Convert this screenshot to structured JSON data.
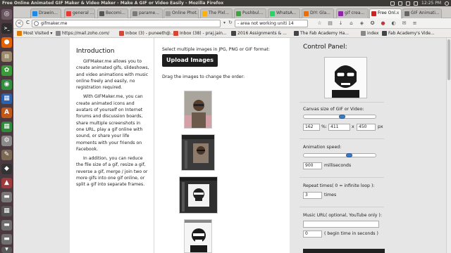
{
  "topbar": {
    "title": "Free Online Animated GIF Maker & Video Maker - Make A GIF or Video Easily - Mozilla Firefox",
    "time": "12:25 PM"
  },
  "tabs": [
    {
      "label": "Drawin...",
      "color": "#1e88e5"
    },
    {
      "label": "general ...",
      "color": "#e53935"
    },
    {
      "label": "Becomi...",
      "color": "#555555"
    },
    {
      "label": "parame...",
      "color": "#7a7a7a"
    },
    {
      "label": "Online Phot...",
      "color": "#999999"
    },
    {
      "label": "The Pixl...",
      "color": "#ffb300"
    },
    {
      "label": "Pushbul...",
      "color": "#43a047"
    },
    {
      "label": "WhatsA...",
      "color": "#25d366"
    },
    {
      "label": "DIY: Gla...",
      "color": "#ef6c00"
    },
    {
      "label": "gif crea...",
      "color": "#8e24aa"
    },
    {
      "label": "Free Onl...",
      "color": "#cc2222"
    },
    {
      "label": "GIF Animati...",
      "color": "#666666"
    }
  ],
  "navbar": {
    "url": "gifmaker.me",
    "search": "- area not working uniti 14",
    "reload": "C",
    "back": "<"
  },
  "bookmarks": [
    {
      "label": "Most Visited ▾",
      "color": "#e07a00"
    },
    {
      "label": "https://mail.zoho.com/",
      "color": "#888888"
    },
    {
      "label": "Inbox (3) - puneeth@...",
      "color": "#d44638"
    },
    {
      "label": "Inbox (38) - praj.jain...",
      "color": "#d44638"
    },
    {
      "label": "2016 Assignments & ...",
      "color": "#444444"
    },
    {
      "label": "The Fab Academy Ha...",
      "color": "#444444"
    },
    {
      "label": "index",
      "color": "#888888"
    },
    {
      "label": "Fab Academy's Vide...",
      "color": "#444444"
    }
  ],
  "intro": {
    "title": "Introduction",
    "p1": "GIFMaker.me allows you to create animated gifs, slideshows, and video animations with music online freely and easily, no registration required.",
    "p2": "With GIFMaker.me, you can create animated icons and avatars of yourself on Internet forums and discussion boards, share multiple screenshots in one URL, play a gif online with sound, or share your life moments with your friends on Facebook.",
    "p3": "In addition, you can reduce the file size of a gif, resize a gif, reverse a gif, merge / join two or more gifs into one gif online, or split a gif into separate frames."
  },
  "main": {
    "select_label": "Select multiple images in JPG, PNG or GIF format:",
    "upload_label": "Upload Images",
    "drag_label": "Drag the images to change the order:"
  },
  "panel": {
    "title": "Control Panel:",
    "canvas_label": "Canvas size of GIF or Video:",
    "canvas_percent": "162",
    "percent_sign": "%:",
    "canvas_width": "411",
    "x_sign": "x",
    "canvas_height": "450",
    "px_label": "px",
    "speed_label": "Animation speed:",
    "speed_value": "900",
    "ms_label": "milliseconds",
    "repeat_label": "Repeat times( 0 = infinite loop ):",
    "repeat_value": "3",
    "times_label": "times",
    "music_label": "Music URL( optional, YouTube only ):",
    "music_value": "",
    "begin_value": "0",
    "begin_label": "( begin time in seconds )"
  },
  "colors": {
    "accent": "#3b79c4",
    "button": "#1e1e1e"
  }
}
